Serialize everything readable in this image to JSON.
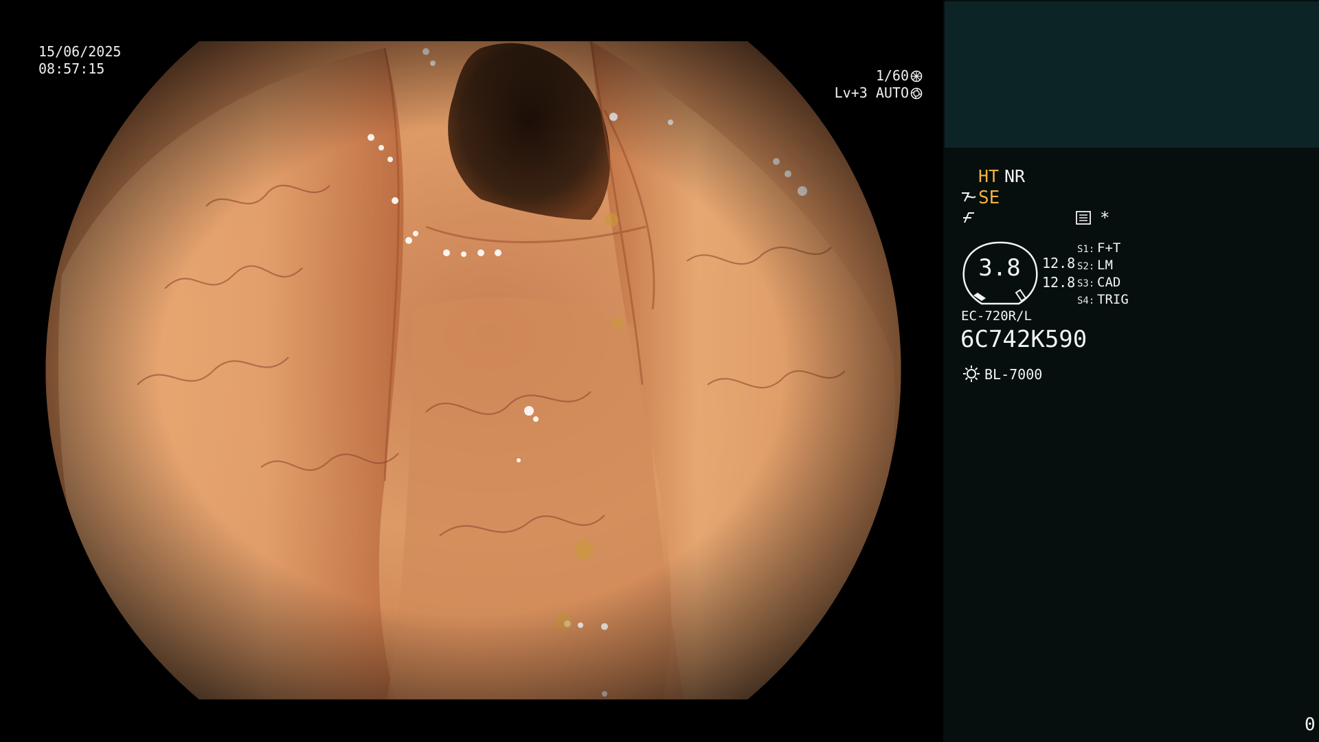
{
  "overlay": {
    "date": "15/06/2025",
    "time": "08:57:15",
    "shutter": "1/60",
    "level": "Lv+3",
    "iris": "AUTO"
  },
  "panel": {
    "ht": "HT",
    "nr": "NR",
    "se": "SE",
    "star": "*",
    "zoom": "3.8",
    "value_top": "12.8",
    "value_bottom": "12.8",
    "switches": [
      {
        "label": "S1:",
        "value": "F+T"
      },
      {
        "label": "S2:",
        "value": "LM"
      },
      {
        "label": "S3:",
        "value": "CAD"
      },
      {
        "label": "S4:",
        "value": "TRIG"
      }
    ],
    "model": "EC-720R/L",
    "serial": "6C742K590",
    "light_source": "BL-7000",
    "counter": "0"
  },
  "colors": {
    "accent": "#f2b23c",
    "panel_bg": "#060e0e",
    "panel_top_bg": "#0c2426",
    "mucosa": "#d9915c"
  },
  "icons": [
    "shutter-icon",
    "iris-icon",
    "scope-se-icon",
    "edge-enhance-icon",
    "menu-icon",
    "sun-icon"
  ]
}
